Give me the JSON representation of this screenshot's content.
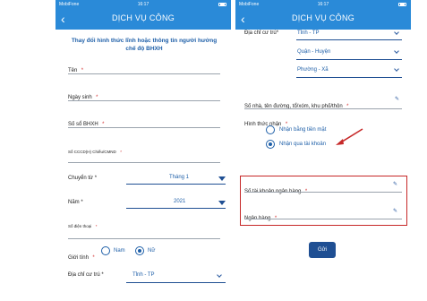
{
  "left": {
    "status": {
      "carrier": "MobiFone",
      "time": "16:17"
    },
    "nav": {
      "title": "DỊCH VỤ CÔNG",
      "back": "‹"
    },
    "heading": "Thay đổi hình thức lĩnh hoặc thông tin người hưởng chế độ BHXH",
    "fields": {
      "name": "Tên",
      "dob": "Ngày sinh",
      "bhxh_no": "Số sổ BHXH",
      "id_no": "Số CCCD(H) Chiếu/CMND",
      "phone": "Số điện thoại"
    },
    "transfer_from": {
      "label": "Chuyển từ",
      "value": "Tháng 1"
    },
    "year": {
      "label": "Năm",
      "value": "2021"
    },
    "gender": {
      "label": "Giới tính",
      "options": [
        "Nam",
        "Nữ"
      ],
      "selected": "Nữ"
    },
    "address": {
      "label": "Địa chỉ cư trú",
      "value": "Tỉnh - TP"
    },
    "asterisk": "*"
  },
  "right": {
    "status": {
      "carrier": "MobiFone",
      "time": "16:17"
    },
    "nav": {
      "title": "DỊCH VỤ CÔNG",
      "back": "‹"
    },
    "address": {
      "label": "Địa chỉ cư trú",
      "province": "Tỉnh - TP",
      "district": "Quận - Huyện",
      "ward": "Phường - Xã"
    },
    "street": "Số nhà, tên đường, tổ/xóm, khu phố/thôn",
    "receive_method": {
      "label": "Hình thức nhận",
      "options": [
        "Nhận bằng tiền mặt",
        "Nhận qua tài khoản"
      ],
      "selected": "Nhận qua tài khoản"
    },
    "bank_account": "Số tài khoản ngân hàng",
    "bank": "Ngân hàng",
    "send_button": "Gửi",
    "asterisk": "*"
  },
  "colors": {
    "primary": "#2a8ad8",
    "accent": "#1e5fa8",
    "highlight": "#c62828"
  },
  "icons": {
    "pencil": "✎"
  }
}
